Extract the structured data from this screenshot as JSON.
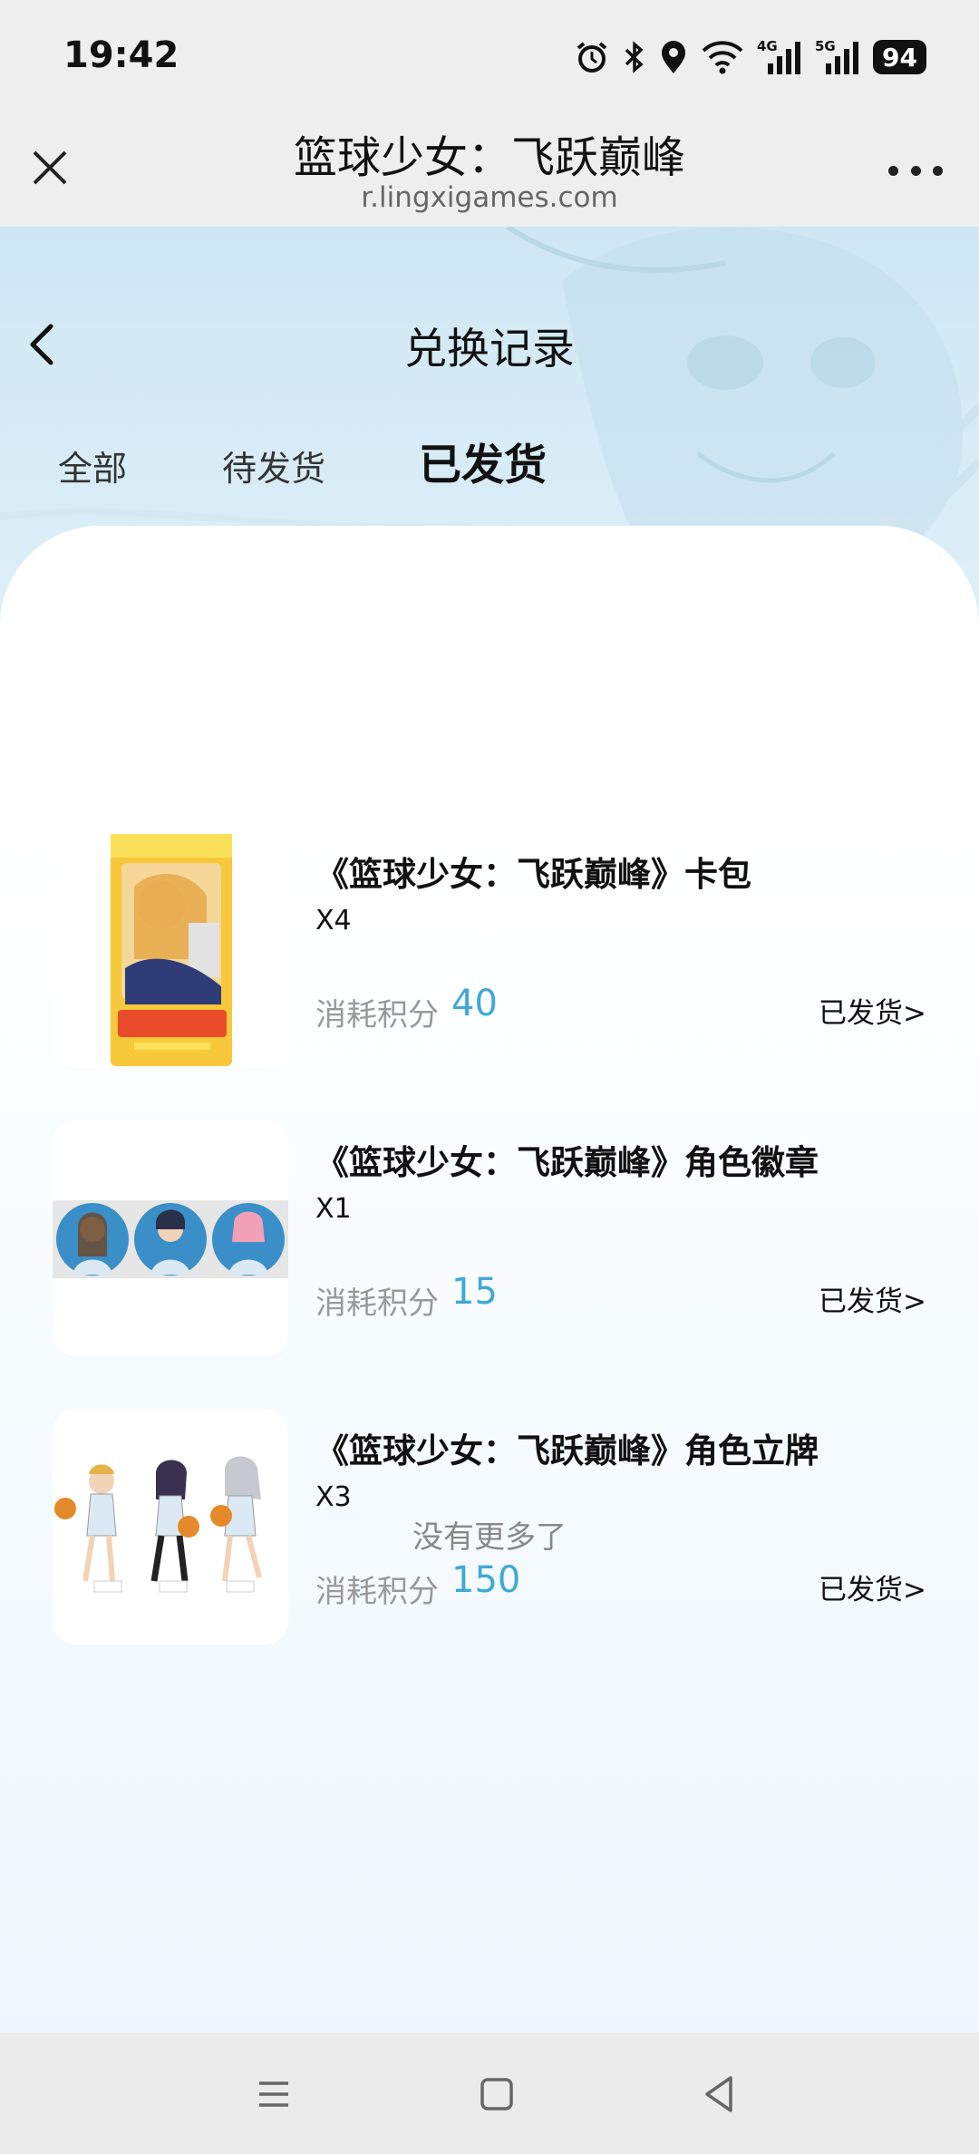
{
  "status_bar": {
    "time": "19:42",
    "battery": "94",
    "net1": "4G",
    "net2": "5G"
  },
  "browser": {
    "title": "篮球少女：飞跃巅峰",
    "url": "r.lingxigames.com",
    "close_icon": "close-icon",
    "more_icon": "more-dots-icon"
  },
  "page": {
    "title": "兑换记录",
    "tabs": [
      {
        "label": "全部",
        "active": false
      },
      {
        "label": "待发货",
        "active": false
      },
      {
        "label": "已发货",
        "active": true
      }
    ],
    "cost_label": "消耗积分",
    "items": [
      {
        "name": "《篮球少女：飞跃巅峰》卡包",
        "qty": "X4",
        "cost": "40",
        "status": "已发货>",
        "image": "card-pack-image"
      },
      {
        "name": "《篮球少女：飞跃巅峰》角色徽章",
        "qty": "X1",
        "cost": "15",
        "status": "已发货>",
        "image": "badges-image"
      },
      {
        "name": "《篮球少女：飞跃巅峰》角色立牌",
        "qty": "X3",
        "cost": "150",
        "status": "已发货>",
        "image": "standees-image"
      }
    ],
    "no_more": "没有更多了"
  },
  "colors": {
    "accent": "#3fa8d6",
    "background": "#eef8fc"
  }
}
